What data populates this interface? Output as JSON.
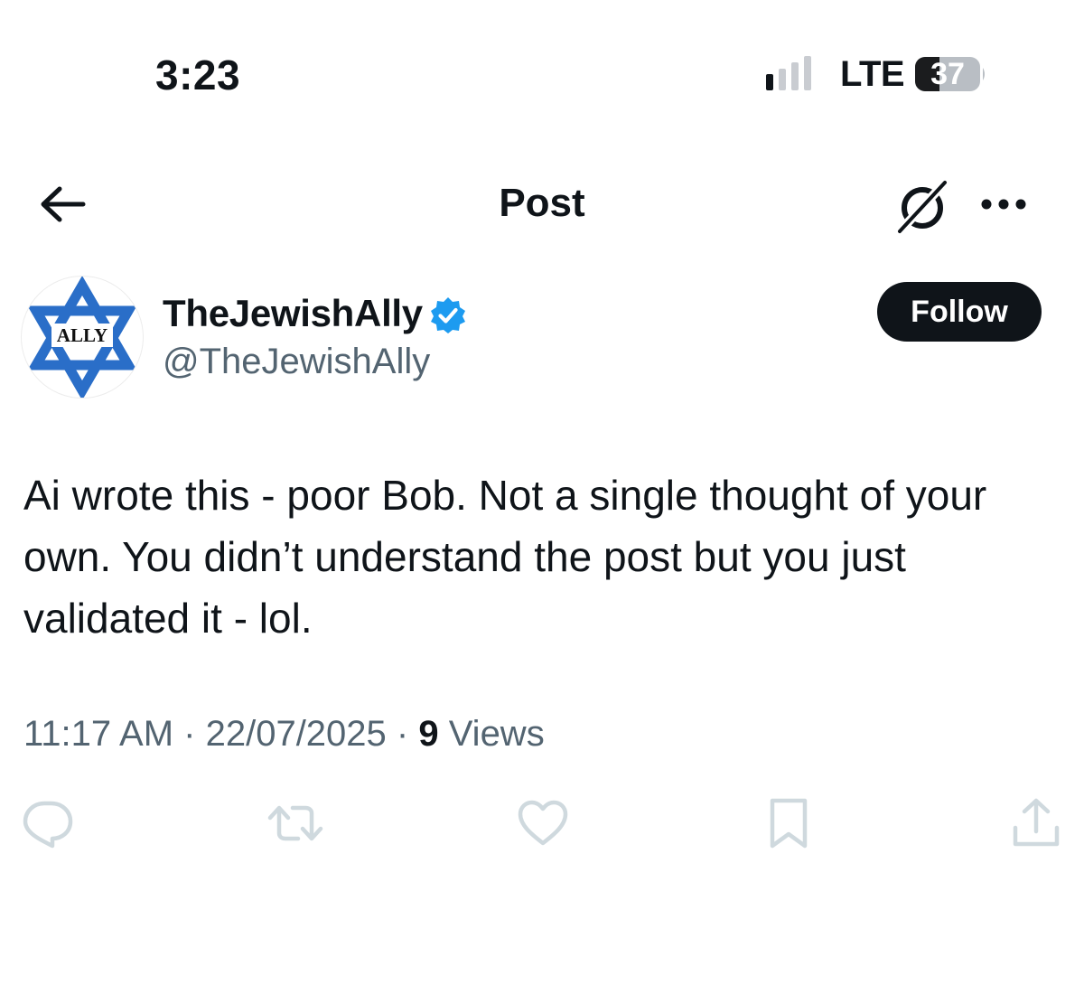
{
  "status_bar": {
    "time": "3:23",
    "network": "LTE",
    "battery": "37"
  },
  "nav": {
    "title": "Post"
  },
  "author": {
    "display_name": "TheJewishAlly",
    "handle": "@TheJewishAlly",
    "avatar_text": "ALLY"
  },
  "follow_label": "Follow",
  "post": {
    "text": "Ai wrote this - poor Bob. Not a single thought of your own. You didn’t understand the post but you just validated it - lol.",
    "time": "11:17 AM",
    "date": "22/07/2025",
    "views_count": "9",
    "views_label": "Views"
  },
  "icons": {
    "back": "arrow-left-icon",
    "grok": "grok-icon",
    "more": "more-icon",
    "verified": "verified-badge-icon",
    "reply": "reply-icon",
    "repost": "repost-icon",
    "like": "heart-icon",
    "bookmark": "bookmark-icon",
    "share": "share-icon"
  },
  "colors": {
    "text_primary": "#0f1419",
    "text_secondary": "#536471",
    "verified_blue": "#1d9bf0",
    "action_icons": "#cfd9de",
    "star_blue": "#2a6ec8"
  }
}
